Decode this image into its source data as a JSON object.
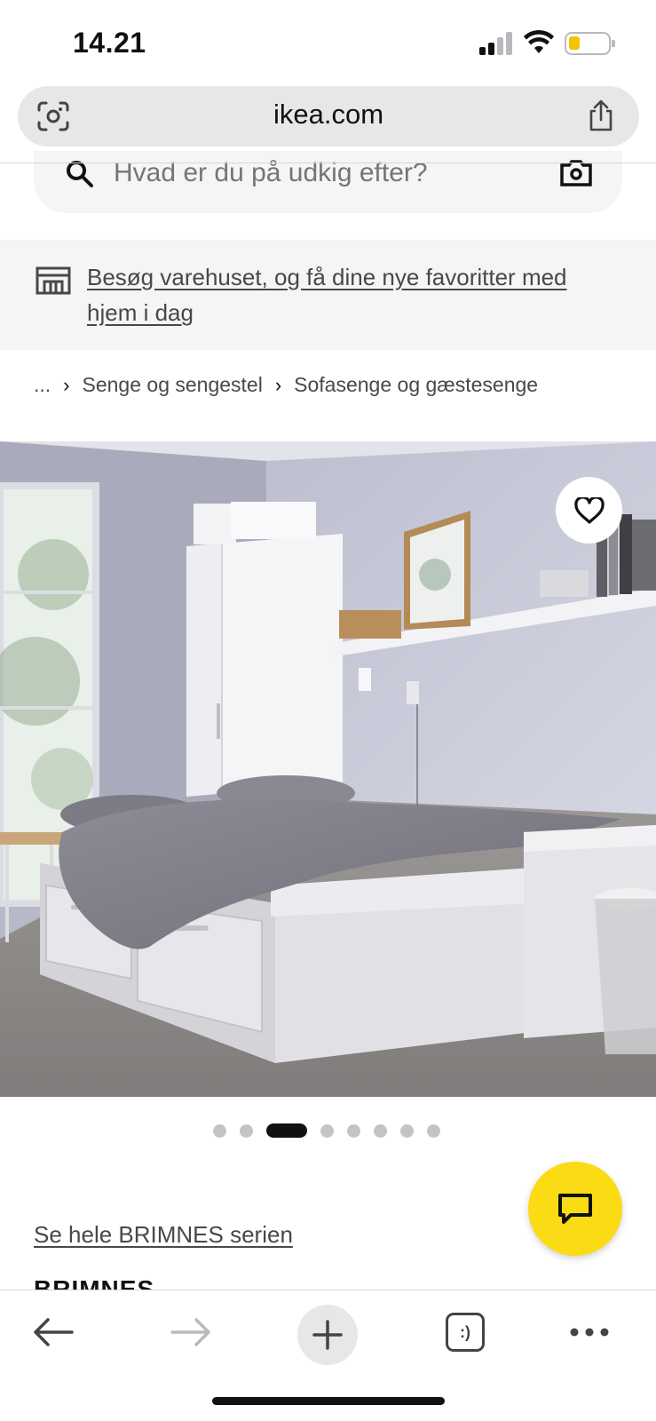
{
  "status_bar": {
    "time": "14.21",
    "signal_icon": "cellular-signal-icon",
    "wifi_icon": "wifi-icon",
    "battery_icon": "battery-icon",
    "battery_color": "#f2c500"
  },
  "browser": {
    "url": "ikea.com",
    "left_icon": "visual-search-icon",
    "right_icon": "share-icon"
  },
  "search": {
    "placeholder": "Hvad er du på udkig efter?",
    "left_icon": "search-icon",
    "right_icon": "camera-icon"
  },
  "store_banner": {
    "icon": "store-icon",
    "text": "Besøg varehuset, og få dine nye favoritter med hjem i dag"
  },
  "breadcrumb": {
    "items": [
      "...",
      "Senge og sengestel",
      "Sofasenge og gæstesenge"
    ],
    "separator": "›"
  },
  "gallery": {
    "favorite_icon": "heart-icon",
    "dot_count": 8,
    "active_index": 2
  },
  "product": {
    "series_link": "Se hele BRIMNES serien",
    "name": "BRIMNES"
  },
  "chat": {
    "icon": "chat-icon",
    "color": "#fadb14"
  },
  "toolbar": {
    "items": [
      "back-arrow-icon",
      "forward-arrow-icon",
      "new-tab-plus-icon",
      "tabs-icon",
      "more-icon"
    ],
    "tabs_label": ":)"
  }
}
